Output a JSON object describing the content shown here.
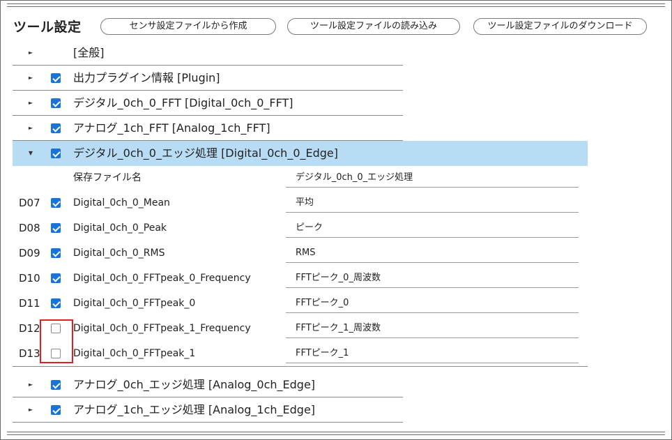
{
  "header": {
    "title": "ツール設定",
    "buttons": {
      "create_from_sensor": "センサ設定ファイルから作成",
      "load_tool_file": "ツール設定ファイルの読み込み",
      "download_tool_file": "ツール設定ファイルのダウンロード"
    }
  },
  "sections": [
    {
      "label": "[全般]",
      "expanded": false,
      "checkbox": false
    },
    {
      "label": "出力プラグイン情報 [Plugin]",
      "expanded": false,
      "checked": true
    },
    {
      "label": "デジタル_0ch_0_FFT [Digital_0ch_0_FFT]",
      "expanded": false,
      "checked": true
    },
    {
      "label": "アナログ_1ch_FFT [Analog_1ch_FFT]",
      "expanded": false,
      "checked": true
    },
    {
      "label": "デジタル_0ch_0_エッジ処理 [Digital_0ch_0_Edge]",
      "expanded": true,
      "checked": true
    },
    {
      "label": "アナログ_0ch_エッジ処理 [Analog_0ch_Edge]",
      "expanded": false,
      "checked": true
    },
    {
      "label": "アナログ_1ch_エッジ処理 [Analog_1ch_Edge]",
      "expanded": false,
      "checked": true
    }
  ],
  "expanded_section": {
    "save_file": {
      "label": "保存ファイル名",
      "value": "デジタル_0ch_0_エッジ処理"
    },
    "params": [
      {
        "code": "D07",
        "name": "Digital_0ch_0_Mean",
        "value": "平均",
        "checked": true
      },
      {
        "code": "D08",
        "name": "Digital_0ch_0_Peak",
        "value": "ピーク",
        "checked": true
      },
      {
        "code": "D09",
        "name": "Digital_0ch_0_RMS",
        "value": "RMS",
        "checked": true
      },
      {
        "code": "D10",
        "name": "Digital_0ch_0_FFTpeak_0_Frequency",
        "value": "FFTピーク_0_周波数",
        "checked": true
      },
      {
        "code": "D11",
        "name": "Digital_0ch_0_FFTpeak_0",
        "value": "FFTピーク_0",
        "checked": true
      },
      {
        "code": "D12",
        "name": "Digital_0ch_0_FFTpeak_1_Frequency",
        "value": "FFTピーク_1_周波数",
        "checked": false
      },
      {
        "code": "D13",
        "name": "Digital_0ch_0_FFTpeak_1",
        "value": "FFTピーク_1",
        "checked": false
      }
    ]
  },
  "colors": {
    "checkbox_checked": "#1a73d9",
    "expanded_row": "#b9dcf5",
    "highlight_box": "#e02020"
  },
  "icons": {
    "collapsed": "triangle-right-icon",
    "expanded": "triangle-down-icon"
  }
}
